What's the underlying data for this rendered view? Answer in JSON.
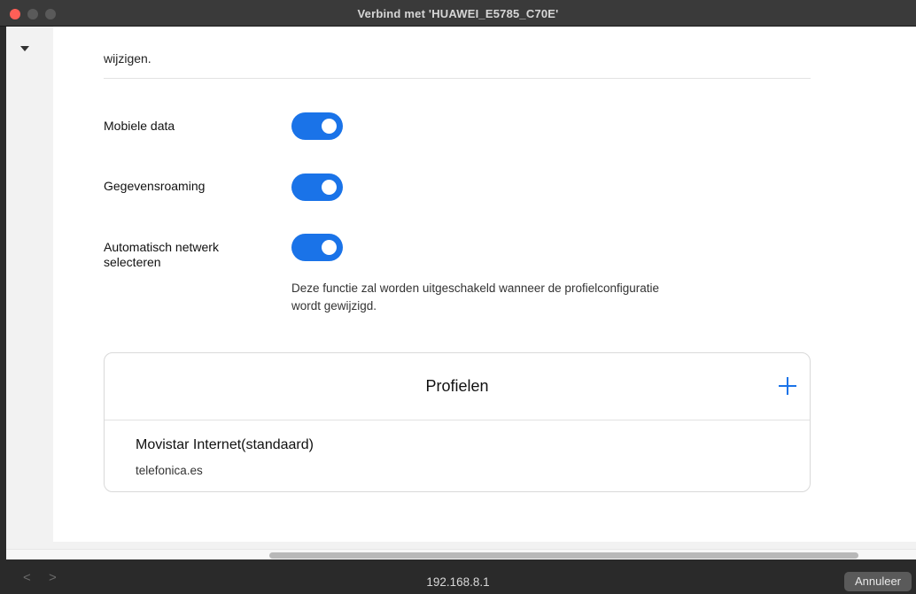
{
  "window": {
    "title": "Verbind met 'HUAWEI_E5785_C70E'"
  },
  "content": {
    "intro_text": "wijzigen.",
    "settings": [
      {
        "label": "Mobiele data",
        "enabled": true
      },
      {
        "label": "Gegevensroaming",
        "enabled": true
      },
      {
        "label": "Automatisch netwerk selecteren",
        "enabled": true
      }
    ],
    "hint": "Deze functie zal worden uitgeschakeld wanneer de profielconfiguratie wordt gewijzigd.",
    "profiles": {
      "title": "Profielen",
      "add_icon": "plus-icon",
      "items": [
        {
          "name": "Movistar Internet(standaard)",
          "apn": "telefonica.es"
        }
      ]
    }
  },
  "bottom_bar": {
    "address": "192.168.8.1",
    "back_icon": "<",
    "forward_icon": ">",
    "cancel_label": "Annuleer"
  },
  "colors": {
    "accent": "#1a73e8",
    "close_button": "#ff5f57"
  }
}
